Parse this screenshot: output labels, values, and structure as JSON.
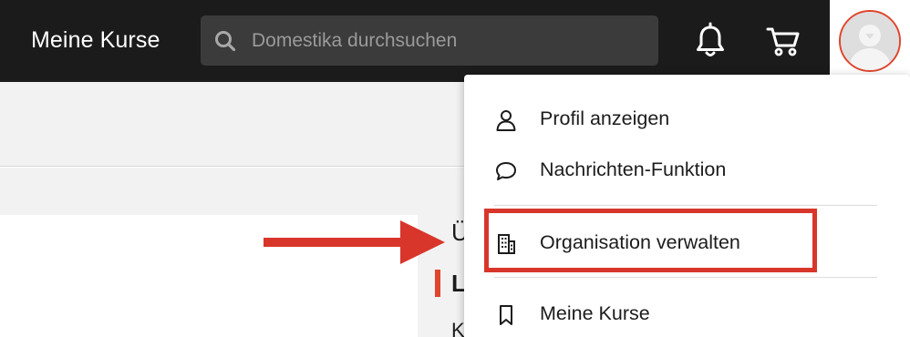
{
  "header": {
    "brand": "Meine Kurse",
    "search": {
      "placeholder": "Domestika durchsuchen",
      "value": ""
    },
    "icons": [
      "search-icon",
      "bell-icon",
      "cart-icon",
      "avatar"
    ]
  },
  "sidebar": {
    "items": [
      {
        "label": "Ü"
      },
      {
        "label": "L",
        "active": true
      },
      {
        "label": "K"
      }
    ]
  },
  "dropdown": {
    "items": [
      {
        "label": "Profil anzeigen",
        "icon": "user-icon"
      },
      {
        "label": "Nachrichten-Funktion",
        "icon": "chat-bubble-icon"
      },
      {
        "label": "Organisation verwalten",
        "icon": "building-icon",
        "highlighted": true
      },
      {
        "label": "Meine Kurse",
        "icon": "bookmark-icon"
      }
    ]
  },
  "colors": {
    "header_bg": "#1b1b1b",
    "search_bg": "#3b3b3b",
    "accent": "#e0452d",
    "annotation": "#d9362b",
    "panel_bg": "#f2f2f2"
  }
}
